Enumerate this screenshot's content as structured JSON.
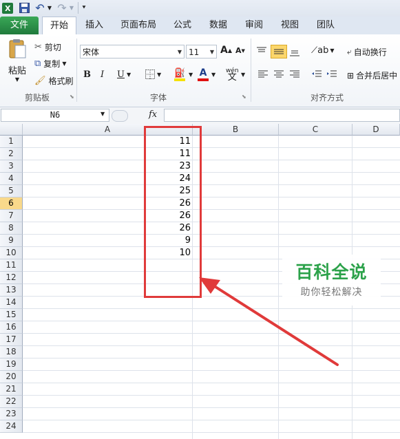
{
  "qat": {
    "undo_label": "↶",
    "redo_label": "↷"
  },
  "tabs": [
    {
      "label": "文件"
    },
    {
      "label": "开始"
    },
    {
      "label": "插入"
    },
    {
      "label": "页面布局"
    },
    {
      "label": "公式"
    },
    {
      "label": "数据"
    },
    {
      "label": "审阅"
    },
    {
      "label": "视图"
    },
    {
      "label": "团队"
    }
  ],
  "ribbon": {
    "clipboard": {
      "paste": "粘贴",
      "cut": "剪切",
      "copy": "复制",
      "format_painter": "格式刷",
      "group": "剪贴板"
    },
    "font": {
      "font_name": "宋体",
      "font_size": "11",
      "grow": "A",
      "shrink": "A",
      "bold": "B",
      "italic": "I",
      "underline": "U",
      "phonetic": "wén",
      "group": "字体"
    },
    "alignment": {
      "wrap_text": "自动换行",
      "merge_center": "合并后居中",
      "group": "对齐方式"
    }
  },
  "formula_bar": {
    "name_box": "N6",
    "fx": "fx",
    "formula": ""
  },
  "sheet": {
    "columns": [
      "A",
      "B",
      "C",
      "D"
    ],
    "rows": [
      "1",
      "2",
      "3",
      "4",
      "5",
      "6",
      "7",
      "8",
      "9",
      "10",
      "11",
      "12",
      "13",
      "14",
      "15",
      "16",
      "17",
      "18",
      "19",
      "20",
      "21",
      "22",
      "23",
      "24"
    ],
    "selected_row": "6",
    "values": [
      "11",
      "11",
      "23",
      "24",
      "25",
      "26",
      "26",
      "26",
      "9",
      "10"
    ]
  },
  "colors": {
    "highlight": "#e03a3a",
    "file_tab": "#1f7a3c",
    "selected_row_header": "#f9d98b",
    "watermark": "#2ca24a"
  },
  "watermark": {
    "title": "百科全说",
    "subtitle": "助你轻松解决"
  }
}
